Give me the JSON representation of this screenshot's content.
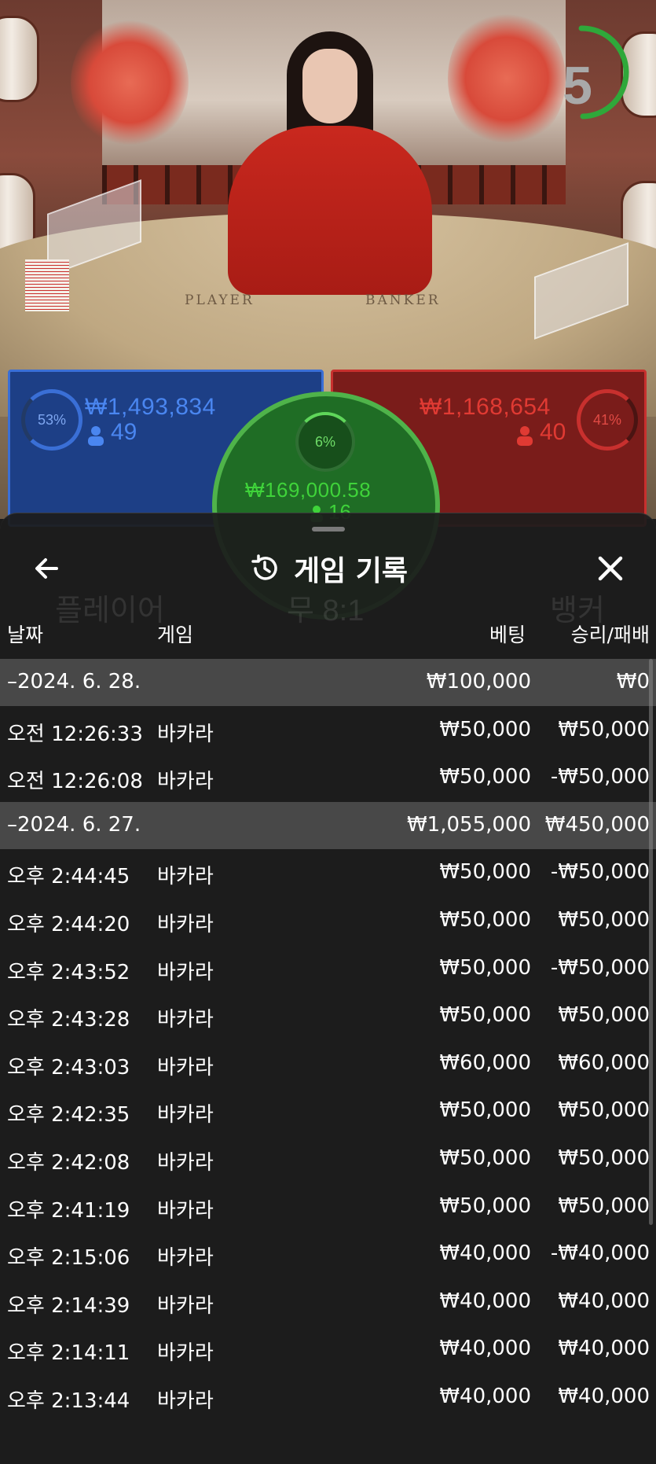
{
  "video": {
    "table_left_word": "PLAYER",
    "table_right_word": "BANKER",
    "countdown": "5"
  },
  "betting_panels": {
    "player": {
      "percent": "53%",
      "amount": "₩1,493,834",
      "count": "49",
      "color": "#3a6fd6"
    },
    "banker": {
      "percent": "41%",
      "amount": "₩1,168,654",
      "count": "40",
      "color": "#c8302e"
    },
    "tie": {
      "percent": "6%",
      "amount": "₩169,000.58",
      "count": "16",
      "color": "#4fb34a"
    }
  },
  "background_labels": {
    "player": "플레이어",
    "tie": "무 8:1",
    "banker": "뱅커"
  },
  "history": {
    "title": "게임 기록",
    "title_icon": "history-icon",
    "back_icon": "arrow-left-icon",
    "close_icon": "close-icon",
    "columns": {
      "date": "날짜",
      "game": "게임",
      "bet": "베팅",
      "win_loss": "승리/패배"
    },
    "rows": [
      {
        "type": "day",
        "time": "–2024. 6. 28.",
        "game": "",
        "bet": "₩100,000",
        "win": "₩0"
      },
      {
        "type": "entry",
        "time": "오전 12:26:33",
        "game": "바카라",
        "bet": "₩50,000",
        "win": "₩50,000"
      },
      {
        "type": "entry",
        "time": "오전 12:26:08",
        "game": "바카라",
        "bet": "₩50,000",
        "win": "-₩50,000"
      },
      {
        "type": "day",
        "time": "–2024. 6. 27.",
        "game": "",
        "bet": "₩1,055,000",
        "win": "₩450,000"
      },
      {
        "type": "entry",
        "time": "오후 2:44:45",
        "game": "바카라",
        "bet": "₩50,000",
        "win": "-₩50,000"
      },
      {
        "type": "entry",
        "time": "오후 2:44:20",
        "game": "바카라",
        "bet": "₩50,000",
        "win": "₩50,000"
      },
      {
        "type": "entry",
        "time": "오후 2:43:52",
        "game": "바카라",
        "bet": "₩50,000",
        "win": "-₩50,000"
      },
      {
        "type": "entry",
        "time": "오후 2:43:28",
        "game": "바카라",
        "bet": "₩50,000",
        "win": "₩50,000"
      },
      {
        "type": "entry",
        "time": "오후 2:43:03",
        "game": "바카라",
        "bet": "₩60,000",
        "win": "₩60,000"
      },
      {
        "type": "entry",
        "time": "오후 2:42:35",
        "game": "바카라",
        "bet": "₩50,000",
        "win": "₩50,000"
      },
      {
        "type": "entry",
        "time": "오후 2:42:08",
        "game": "바카라",
        "bet": "₩50,000",
        "win": "₩50,000"
      },
      {
        "type": "entry",
        "time": "오후 2:41:19",
        "game": "바카라",
        "bet": "₩50,000",
        "win": "₩50,000"
      },
      {
        "type": "entry",
        "time": "오후 2:15:06",
        "game": "바카라",
        "bet": "₩40,000",
        "win": "-₩40,000"
      },
      {
        "type": "entry",
        "time": "오후 2:14:39",
        "game": "바카라",
        "bet": "₩40,000",
        "win": "₩40,000"
      },
      {
        "type": "entry",
        "time": "오후 2:14:11",
        "game": "바카라",
        "bet": "₩40,000",
        "win": "₩40,000"
      },
      {
        "type": "entry",
        "time": "오후 2:13:44",
        "game": "바카라",
        "bet": "₩40,000",
        "win": "₩40,000"
      }
    ]
  }
}
